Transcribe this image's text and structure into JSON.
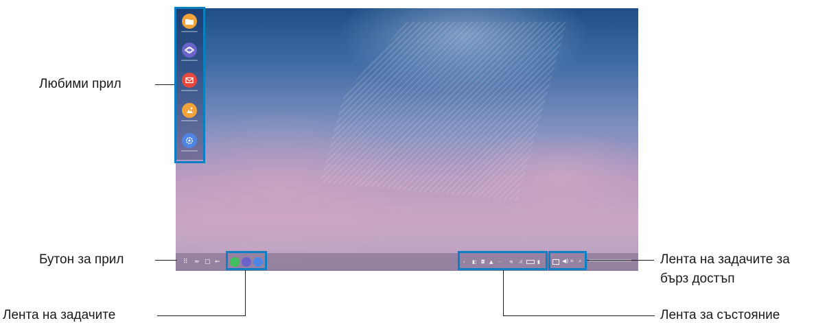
{
  "labels": {
    "favorites": "Любими прил",
    "apps_button": "Бутон за прил",
    "taskbar": "Лента на задачите",
    "quick_access_line1": "Лента на задачите за",
    "quick_access_line2": "бърз достъп",
    "status_bar": "Лента за състояние"
  },
  "favorite_apps": [
    {
      "icon": "folder-icon",
      "color": "#f2a33a"
    },
    {
      "icon": "internet-icon",
      "color": "#6a63c9"
    },
    {
      "icon": "email-icon",
      "color": "#e8483c"
    },
    {
      "icon": "gallery-icon",
      "color": "#f2a33a"
    },
    {
      "icon": "settings-icon",
      "color": "#4f86e6"
    }
  ],
  "nav_icons": [
    "apps-grid-icon",
    "recent-icon",
    "home-icon",
    "back-icon"
  ],
  "running_apps": [
    {
      "icon": "phone-icon",
      "color": "#3fbf5e"
    },
    {
      "icon": "internet-icon",
      "color": "#6a63c9"
    },
    {
      "icon": "settings-icon",
      "color": "#4f86e6"
    }
  ],
  "status_icons": [
    "chevron-icon",
    "notification-icon",
    "lock-icon",
    "upload-icon",
    "dots-icon",
    "wifi-icon",
    "signal-icon",
    "battery-icon",
    "sound-icon"
  ],
  "quick_access_icons": [
    "keyboard-icon",
    "volume-icon",
    "screen-capture-icon",
    "search-icon"
  ],
  "colors": {
    "highlight": "#0b7fc6",
    "callout_line": "#1a1a1a"
  }
}
